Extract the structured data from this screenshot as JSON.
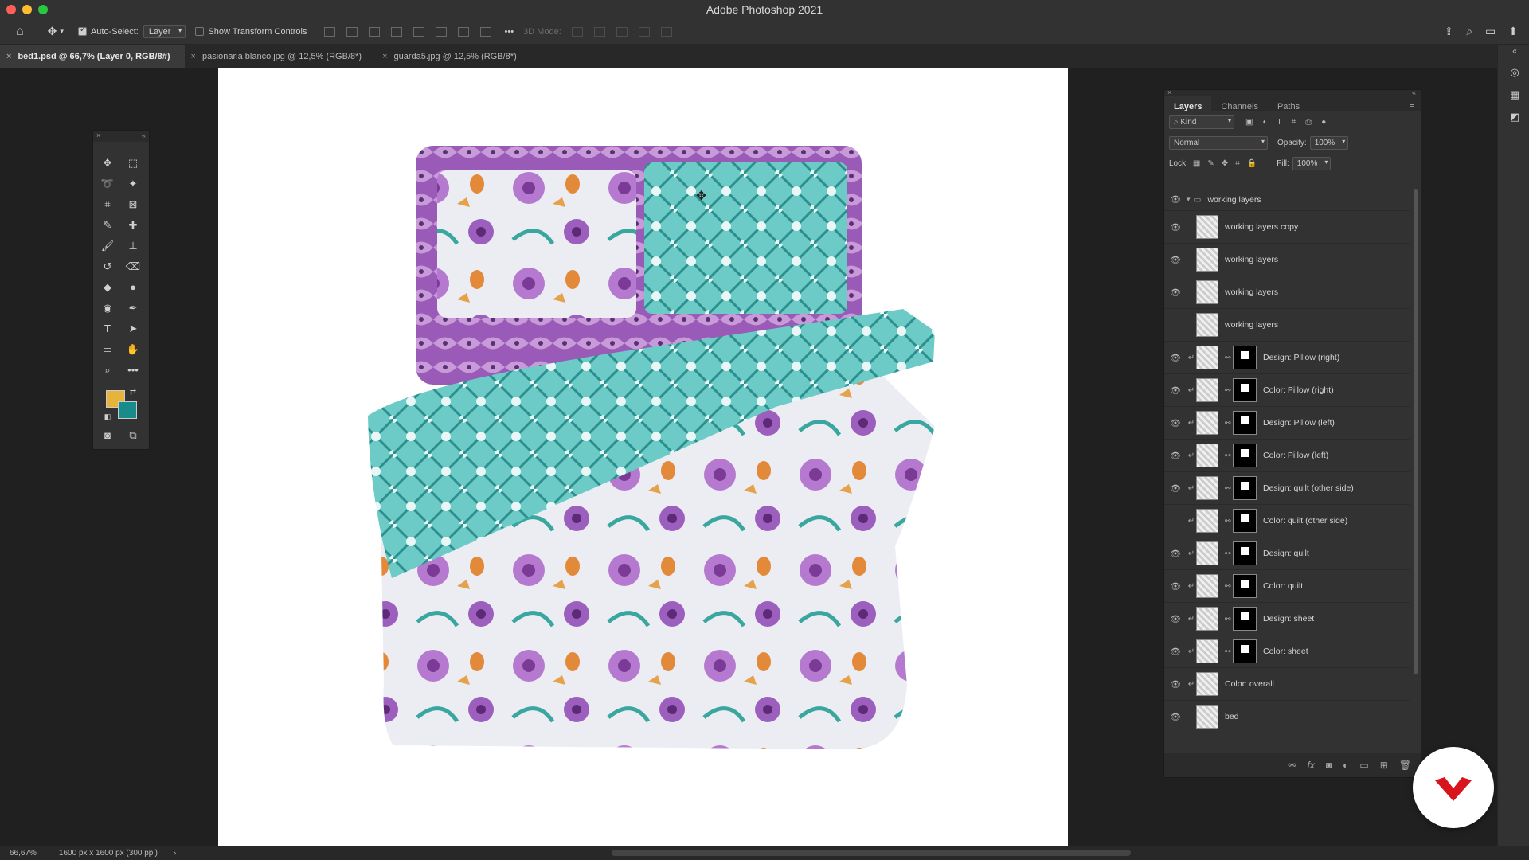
{
  "app": {
    "window_title": "Adobe Photoshop 2021"
  },
  "options_bar": {
    "auto_select_label": "Auto-Select:",
    "auto_select_value": "Layer",
    "show_transform_label": "Show Transform Controls",
    "mode_3d_label": "3D Mode:",
    "more": "•••"
  },
  "tabs": [
    {
      "label": "bed1.psd @ 66,7% (Layer 0, RGB/8#)",
      "active": true
    },
    {
      "label": "pasionaria blanco.jpg @ 12,5% (RGB/8*)",
      "active": false
    },
    {
      "label": "guarda5.jpg @ 12,5% (RGB/8*)",
      "active": false
    }
  ],
  "colors": {
    "foreground": "#e8b33a",
    "background": "#1a8b8b",
    "quilt_teal": "#5fc4c0",
    "border_purple": "#8d4fb0",
    "cover_light": "#eeeef3"
  },
  "layers_panel": {
    "tabs": [
      "Layers",
      "Channels",
      "Paths"
    ],
    "kind_label": "Kind",
    "blend_mode": "Normal",
    "opacity_label": "Opacity:",
    "opacity_value": "100%",
    "lock_label": "Lock:",
    "fill_label": "Fill:",
    "fill_value": "100%",
    "group_name": "working layers",
    "layers": [
      {
        "name": "working layers copy",
        "visible": true,
        "mask": false
      },
      {
        "name": "working layers",
        "visible": true,
        "mask": false
      },
      {
        "name": "working layers",
        "visible": true,
        "mask": false
      },
      {
        "name": "working layers",
        "visible": false,
        "mask": false
      },
      {
        "name": "Design: Pillow (right)",
        "visible": true,
        "mask": true
      },
      {
        "name": "Color: Pillow (right)",
        "visible": true,
        "mask": true
      },
      {
        "name": "Design: Pillow (left)",
        "visible": true,
        "mask": true
      },
      {
        "name": "Color: Pillow (left)",
        "visible": true,
        "mask": true
      },
      {
        "name": "Design: quilt (other side)",
        "visible": true,
        "mask": true
      },
      {
        "name": "Color: quilt (other side)",
        "visible": false,
        "mask": true
      },
      {
        "name": "Design: quilt",
        "visible": true,
        "mask": true
      },
      {
        "name": "Color: quilt",
        "visible": true,
        "mask": true
      },
      {
        "name": "Design: sheet",
        "visible": true,
        "mask": true
      },
      {
        "name": "Color: sheet",
        "visible": true,
        "mask": true
      },
      {
        "name": "Color: overall",
        "visible": true,
        "mask": false
      },
      {
        "name": "bed",
        "visible": true,
        "mask": false
      }
    ]
  },
  "status_bar": {
    "zoom": "66,67%",
    "doc_info": "1600 px x 1600 px (300 ppi)"
  }
}
